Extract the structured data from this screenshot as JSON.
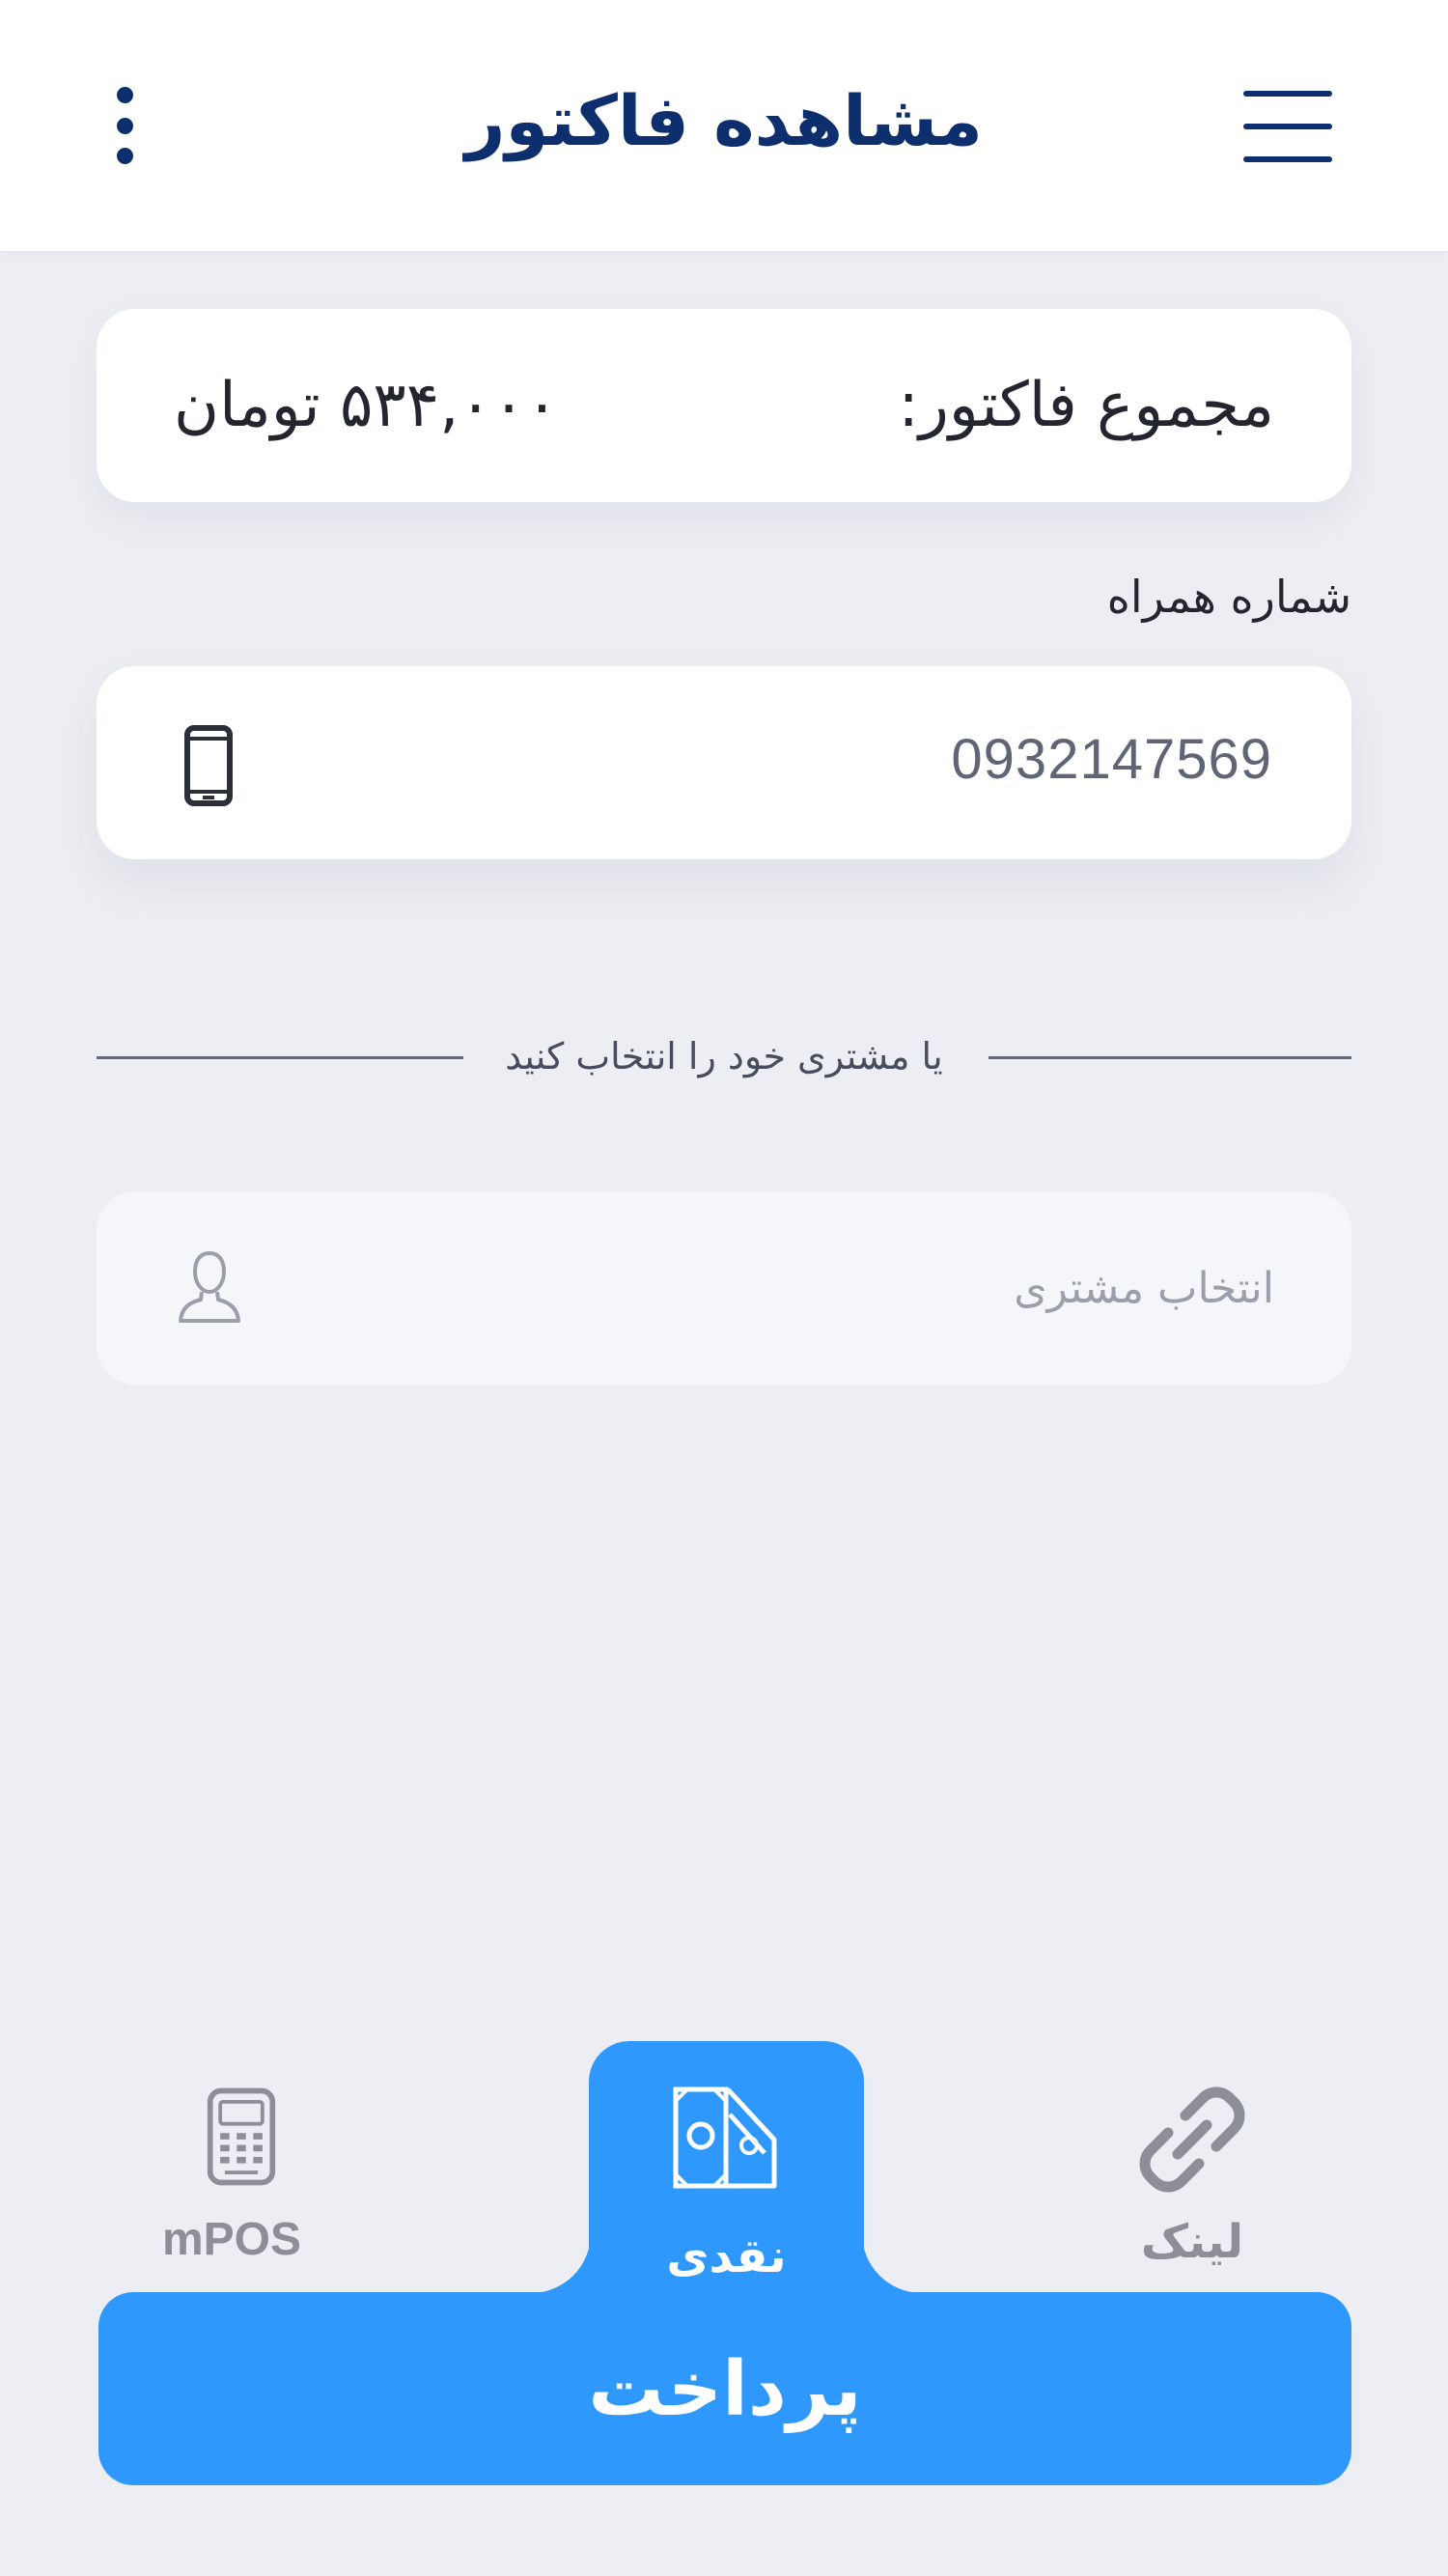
{
  "header": {
    "title": "مشاهده فاکتور",
    "menu_icon": "hamburger-menu-icon",
    "more_icon": "more-vertical-icon"
  },
  "total": {
    "label": "مجموع فاکتور:",
    "amount": "۵۳۴,۰۰۰ تومان"
  },
  "phone": {
    "label": "شماره همراه",
    "value": "0932147569",
    "icon": "mobile-phone-icon"
  },
  "divider": {
    "text": "یا مشتری خود را انتخاب کنید"
  },
  "customer": {
    "placeholder": "انتخاب مشتری",
    "icon": "user-icon"
  },
  "payment_tabs": [
    {
      "label": "mPOS",
      "icon": "pos-terminal-icon",
      "selected": false
    },
    {
      "label": "نقدی",
      "icon": "cash-icon",
      "selected": true
    },
    {
      "label": "لینک",
      "icon": "link-icon",
      "selected": false
    }
  ],
  "pay_button": {
    "label": "پرداخت"
  },
  "colors": {
    "primary": "#2e98fc",
    "header_text": "#0d2f6e",
    "background": "#eceef3"
  }
}
